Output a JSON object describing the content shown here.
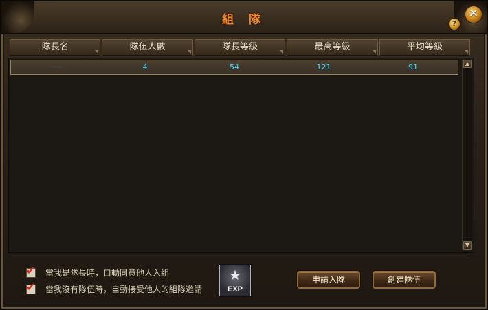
{
  "window": {
    "title": "組 隊",
    "help_glyph": "?",
    "close_glyph": "✕"
  },
  "table": {
    "columns": [
      "隊長名",
      "隊伍人數",
      "隊長等級",
      "最高等級",
      "平均等級"
    ],
    "rows": [
      {
        "leader": "·······",
        "members": "4",
        "leader_level": "54",
        "max_level": "121",
        "avg_level": "91"
      }
    ]
  },
  "scrollbar": {
    "up_glyph": "▲",
    "down_glyph": "▼"
  },
  "options": {
    "auto_accept_label": "當我是隊長時，自動同意他人入組",
    "auto_accept_checked": true,
    "auto_invite_label": "當我沒有隊伍時，自動接受他人的組隊邀請",
    "auto_invite_checked": true,
    "check_glyph": "✔"
  },
  "exp_icon": {
    "label": "EXP",
    "star_glyph": "★"
  },
  "buttons": {
    "apply_label": "申請入隊",
    "create_label": "創建隊伍"
  },
  "colors": {
    "title": "#f08a2c",
    "row_text": "#36d8ff",
    "check": "#e02818"
  }
}
